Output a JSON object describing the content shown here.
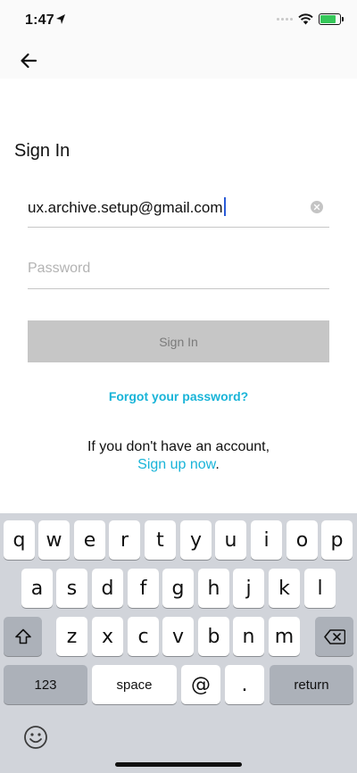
{
  "status_bar": {
    "time": "1:47"
  },
  "nav": {
    "back_icon": "arrow-left-icon"
  },
  "page": {
    "title": "Sign In",
    "email_value": "ux.archive.setup@gmail.com",
    "password_placeholder": "Password",
    "signin_label": "Sign In",
    "forgot_label": "Forgot your password?",
    "no_account_text": "If you don't have an account,",
    "signup_link": "Sign up now",
    "signup_suffix": "."
  },
  "colors": {
    "accent": "#19b4d8",
    "button_disabled": "#c6c6c6",
    "keyboard_bg": "#d1d4da"
  },
  "keyboard": {
    "row1": [
      "q",
      "w",
      "e",
      "r",
      "t",
      "y",
      "u",
      "i",
      "o",
      "p"
    ],
    "row2": [
      "a",
      "s",
      "d",
      "f",
      "g",
      "h",
      "j",
      "k",
      "l"
    ],
    "row3": [
      "z",
      "x",
      "c",
      "v",
      "b",
      "n",
      "m"
    ],
    "row4": {
      "numbers": "123",
      "space": "space",
      "at": "@",
      "dot": ".",
      "return": "return"
    }
  }
}
